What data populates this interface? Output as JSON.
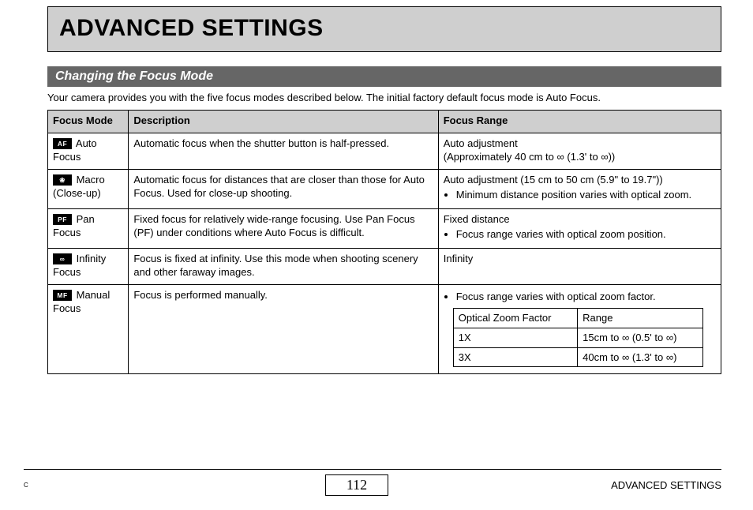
{
  "title": "ADVANCED SETTINGS",
  "subheader": "Changing the Focus Mode",
  "intro": "Your camera provides you with the five focus modes described below. The initial factory default focus mode is Auto Focus.",
  "headers": {
    "mode": "Focus Mode",
    "desc": "Description",
    "range": "Focus Range"
  },
  "rows": {
    "auto": {
      "icon": "AF",
      "label1": "Auto",
      "label2": "Focus",
      "desc": "Automatic focus when the shutter button is half-pressed.",
      "range_l1": "Auto adjustment",
      "range_l2": "(Approximately 40 cm to ∞ (1.3' to ∞))"
    },
    "macro": {
      "icon": "❀",
      "label1": "Macro",
      "label2": "(Close-up)",
      "desc": "Automatic focus for distances that are closer than those for Auto Focus. Used for close-up shooting.",
      "range_l1": "Auto adjustment (15 cm to 50 cm (5.9\" to 19.7\"))",
      "bullet": "Minimum distance position varies with optical zoom."
    },
    "pan": {
      "icon": "PF",
      "label1": "Pan",
      "label2": "Focus",
      "desc": "Fixed focus for relatively wide-range focusing. Use Pan Focus (PF) under conditions where Auto Focus is difficult.",
      "range_l1": "Fixed distance",
      "bullet": "Focus range varies with optical zoom position."
    },
    "infinity": {
      "icon": "∞",
      "label1": "Infinity",
      "label2": "Focus",
      "desc": "Focus is fixed at infinity. Use this mode when shooting scenery and other faraway images.",
      "range_l1": "Infinity"
    },
    "manual": {
      "icon": "MF",
      "label1": "Manual",
      "label2": "Focus",
      "desc": "Focus is performed manually.",
      "bullet": "Focus range varies with optical zoom factor.",
      "inner_h1": "Optical Zoom Factor",
      "inner_h2": "Range",
      "inner_r1c1": "1X",
      "inner_r1c2": "15cm to ∞ (0.5' to ∞)",
      "inner_r2c1": "3X",
      "inner_r2c2": "40cm to ∞ (1.3' to ∞)"
    }
  },
  "footer": {
    "left": "C",
    "page": "112",
    "right": "ADVANCED SETTINGS"
  }
}
